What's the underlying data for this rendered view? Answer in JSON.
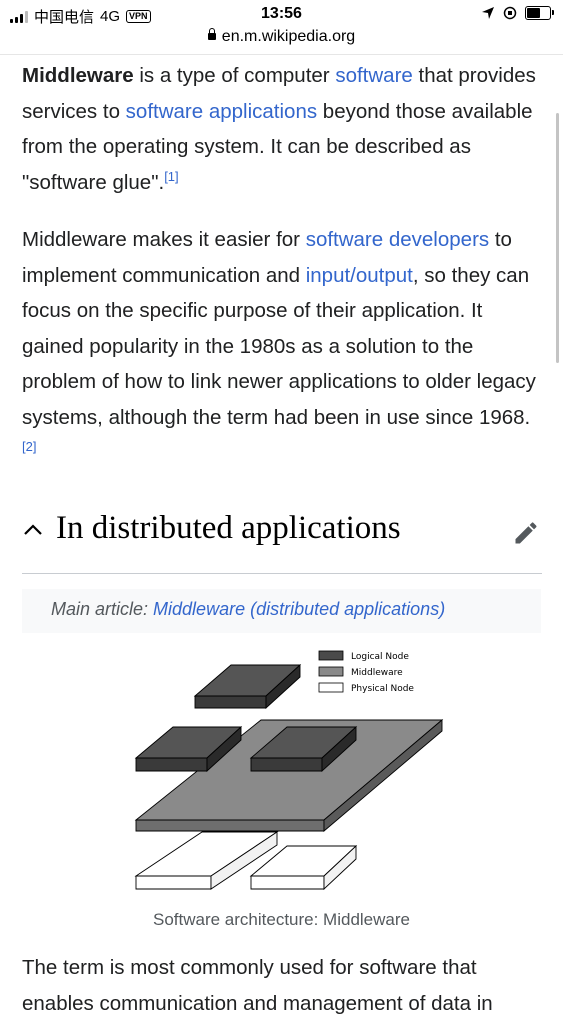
{
  "status_bar": {
    "carrier": "中国电信",
    "network": "4G",
    "vpn": "VPN",
    "time": "13:56",
    "url": "en.m.wikipedia.org",
    "battery_level": 0.55
  },
  "article": {
    "intro": {
      "bold": "Middleware",
      "t1": " is a type of computer ",
      "link1": "software",
      "t2": " that provides services to ",
      "link2": "software applications",
      "t3": " beyond those available from the operating system. It can be described as \"software glue\".",
      "ref1": "[1]"
    },
    "para2": {
      "t1": "Middleware makes it easier for ",
      "link1": "software developers",
      "t2": " to implement communication and ",
      "link2": "input/output",
      "t3": ", so they can focus on the specific purpose of their application. It gained popularity in the 1980s as a solution to the problem of how to link newer applications to older legacy systems, although the term had been in use since 1968.",
      "ref2": "[2]"
    },
    "section": {
      "heading": "In distributed applications",
      "hatnote_prefix": "Main article: ",
      "hatnote_link": "Middleware (distributed applications)"
    },
    "figure": {
      "legend": [
        {
          "label": "Logical Node",
          "color": "#4a4a4a"
        },
        {
          "label": "Middleware",
          "color": "#8a8a8a"
        },
        {
          "label": "Physical Node",
          "color": "#ffffff"
        }
      ],
      "caption": "Software architecture: Middleware"
    },
    "para3": "The term is most commonly used for software that enables communication and management of data in"
  },
  "colors": {
    "link": "#3366cc",
    "text": "#202122",
    "hatnote_bg": "#f8f9fa"
  }
}
